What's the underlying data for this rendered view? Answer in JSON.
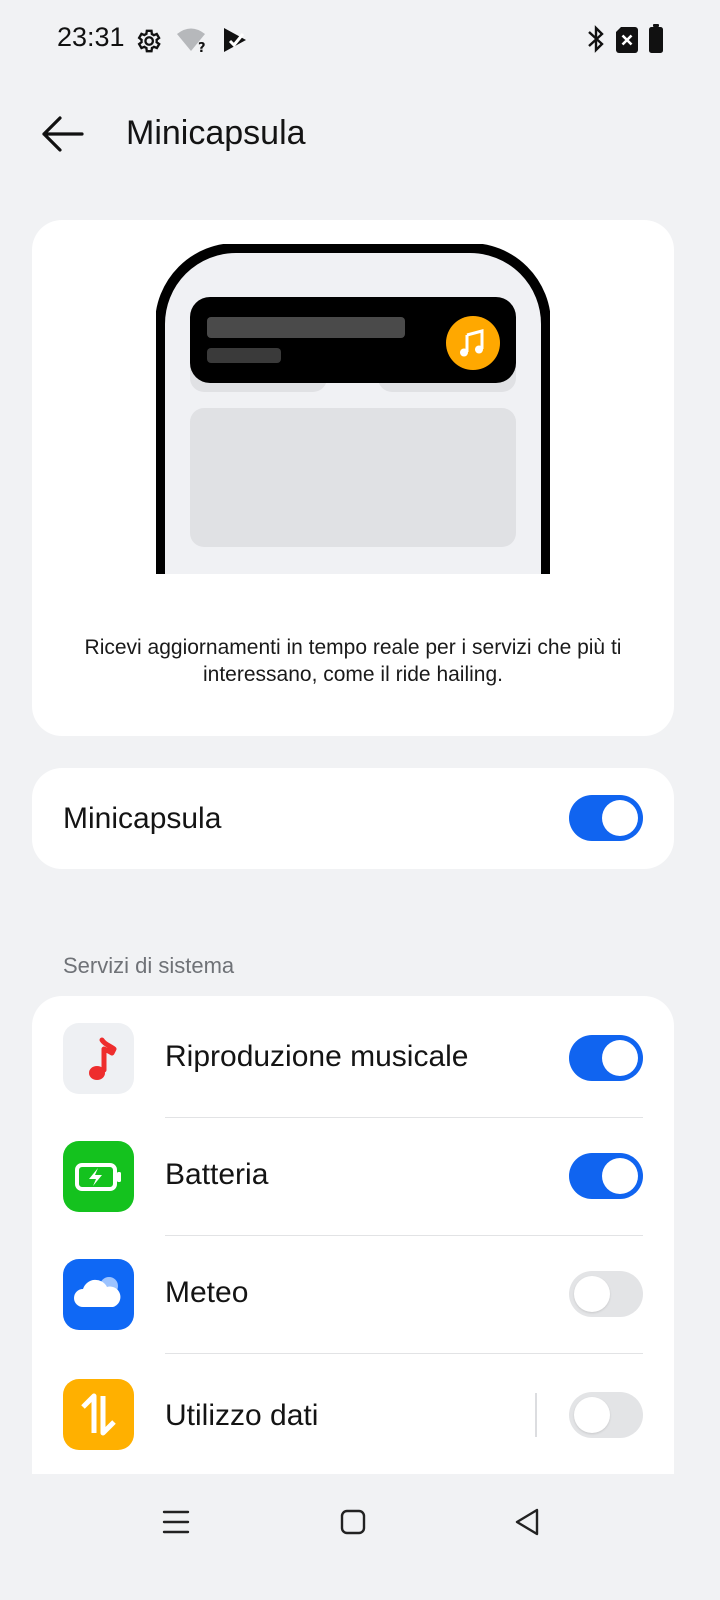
{
  "status_bar": {
    "time": "23:31",
    "left_icons": [
      "gear-icon",
      "wifi-question-icon",
      "play-store-icon"
    ],
    "right_icons": [
      "bluetooth-icon",
      "no-sim-icon",
      "battery-icon"
    ]
  },
  "header": {
    "title": "Minicapsula",
    "back_icon": "back-arrow-icon"
  },
  "illustration": {
    "capsule_icon": "music-note-icon",
    "capsule_color": "#ffa800",
    "description": "Ricevi aggiornamenti in tempo reale per i servizi che più ti interessano, come il ride hailing."
  },
  "main_toggle": {
    "label": "Minicapsula",
    "enabled": true
  },
  "section": {
    "label": "Servizi di sistema"
  },
  "services": [
    {
      "label": "Riproduzione musicale",
      "icon": "music-note-icon",
      "enabled": true
    },
    {
      "label": "Batteria",
      "icon": "battery-charging-icon",
      "enabled": true
    },
    {
      "label": "Meteo",
      "icon": "weather-cloud-icon",
      "enabled": false
    },
    {
      "label": "Utilizzo dati",
      "icon": "data-usage-icon",
      "enabled": false
    }
  ],
  "colors": {
    "accent": "#1064f0",
    "background": "#f1f2f4",
    "battery_green": "#14c21e",
    "meteo_blue": "#0f68f5",
    "data_orange": "#ffb000"
  },
  "nav_bar": {
    "icons": [
      "menu-icon",
      "home-icon",
      "back-triangle-icon"
    ]
  }
}
